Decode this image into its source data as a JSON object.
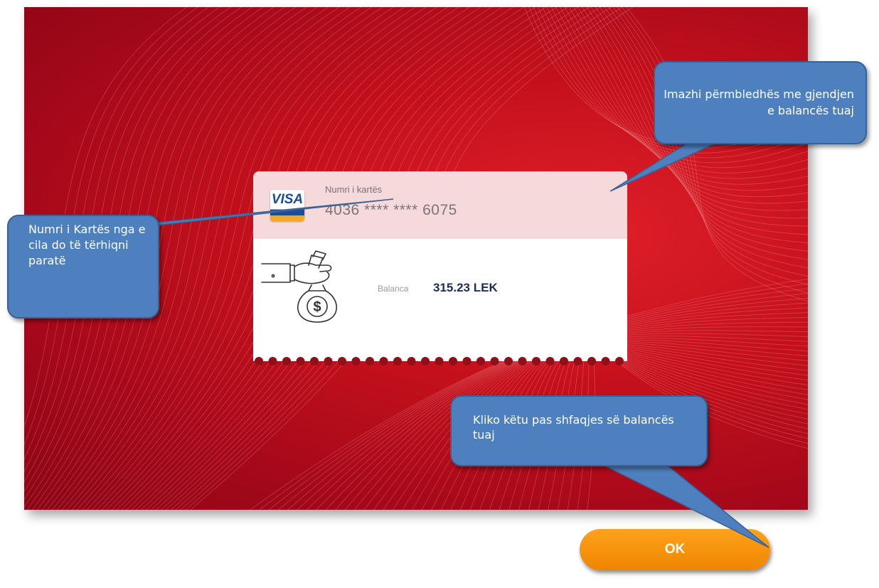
{
  "card": {
    "number_label": "Numri i kartës",
    "number": "4036 **** **** 6075",
    "network": "VISA",
    "balance_label": "Balanca",
    "balance_value": "315.23 LEK"
  },
  "buttons": {
    "ok": "OK"
  },
  "callouts": {
    "card_number": "Numri i Kartës nga e cila do të tërhiqni paratë",
    "summary": "Imazhi përmbledhës me gjendjen e balancës tuaj",
    "ok_hint": "Kliko këtu pas shfaqjes së balancës tuaj"
  },
  "colors": {
    "background_red": "#c4101c",
    "card_header": "#f6dadb",
    "ok_orange": "#f7941d",
    "callout_blue": "#4e80bf",
    "balance_text": "#1b2e55"
  },
  "icons": [
    "visa-card-icon",
    "money-bag-hand-icon"
  ]
}
